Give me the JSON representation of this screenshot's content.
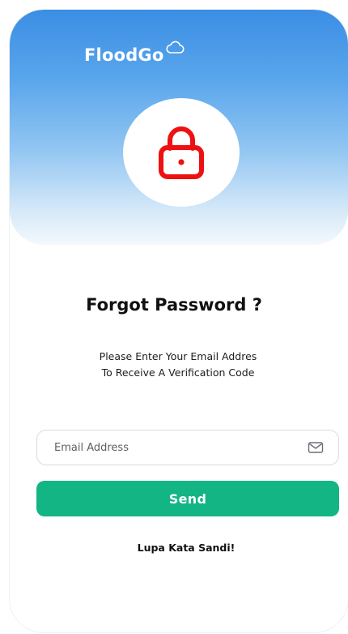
{
  "brand": {
    "name": "FloodGo",
    "icon": "cloud-icon"
  },
  "hero": {
    "icon": "lock-icon",
    "icon_color": "#ee1111",
    "gradient_top": "#3a8ee4",
    "gradient_bottom": "#f4f9fd"
  },
  "main": {
    "title": "Forgot Password ?",
    "subtitle_line1": "Please Enter Your Email Addres",
    "subtitle_line2": "To Receive A Verification Code"
  },
  "form": {
    "email_placeholder": "Email Address",
    "email_value": "",
    "email_icon": "mail-icon",
    "send_label": "Send",
    "send_color": "#13b585"
  },
  "footer": {
    "link_label": "Lupa Kata Sandi!"
  }
}
